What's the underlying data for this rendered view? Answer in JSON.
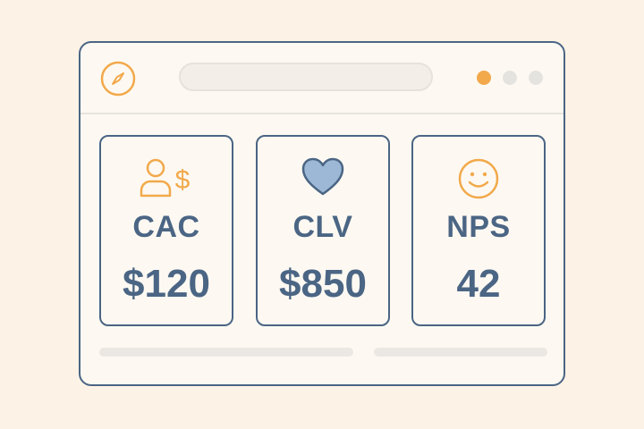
{
  "colors": {
    "accent": "#f2a94b",
    "primary": "#4b6584",
    "heart_fill": "#9cb8d6",
    "background": "#fcf3e6"
  },
  "titlebar": {
    "app_icon": "compass-icon",
    "address_text": ""
  },
  "window_controls": [
    "active-dot",
    "inactive-dot",
    "inactive-dot"
  ],
  "metrics": [
    {
      "icon": "user-dollar-icon",
      "label": "CAC",
      "value": "$120"
    },
    {
      "icon": "heart-icon",
      "label": "CLV",
      "value": "$850"
    },
    {
      "icon": "smiley-icon",
      "label": "NPS",
      "value": "42"
    }
  ]
}
